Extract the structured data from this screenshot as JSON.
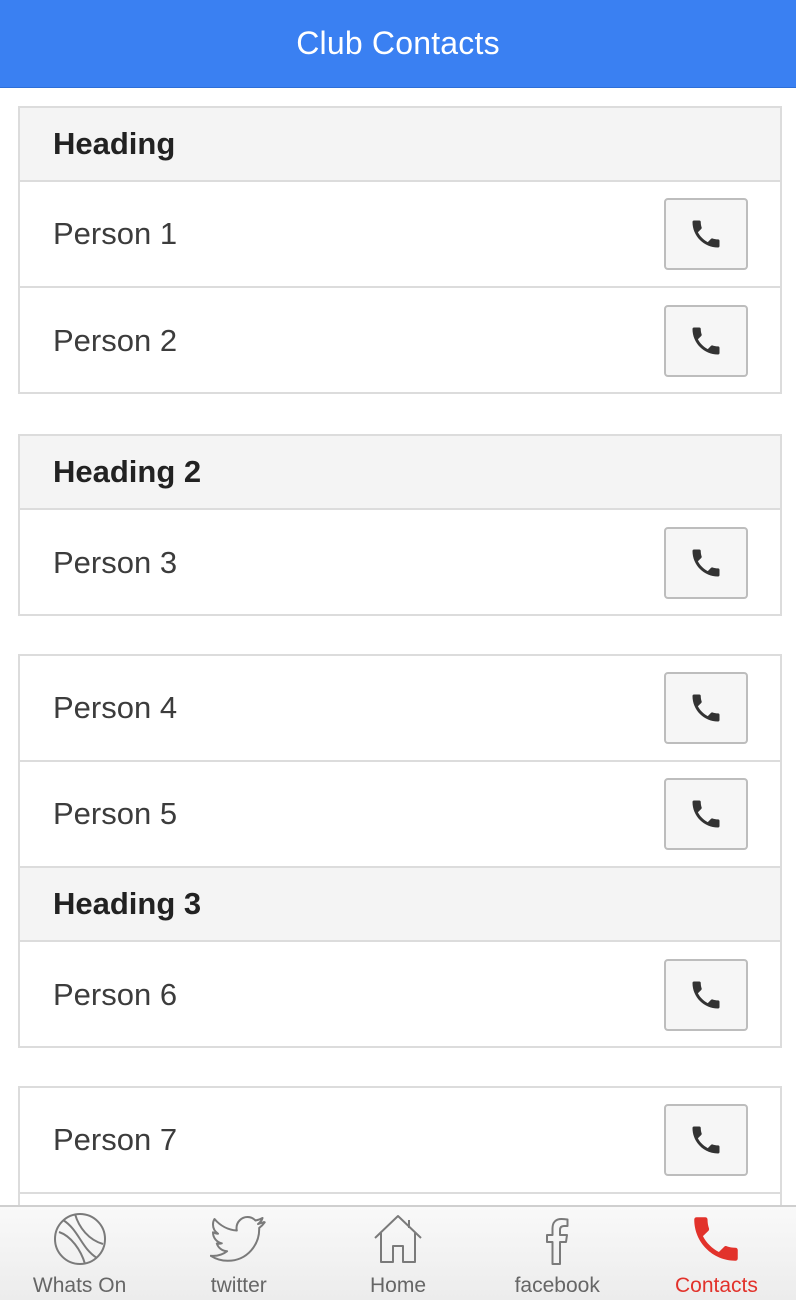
{
  "header": {
    "title": "Club Contacts"
  },
  "cards": [
    {
      "heading": "Heading",
      "people": [
        "Person 1",
        "Person 2"
      ]
    },
    {
      "heading": "Heading 2",
      "people": [
        "Person 3"
      ]
    },
    {
      "people": [
        "Person 4",
        "Person 5"
      ],
      "subheading": "Heading 3",
      "people_after": [
        "Person 6"
      ]
    },
    {
      "people": [
        "Person 7"
      ]
    }
  ],
  "icons": {
    "call": "phone-icon"
  },
  "tabbar": {
    "tabs": [
      {
        "label": "Whats On",
        "icon": "tennis-ball-icon"
      },
      {
        "label": "twitter",
        "icon": "twitter-bird-icon"
      },
      {
        "label": "Home",
        "icon": "house-icon"
      },
      {
        "label": "facebook",
        "icon": "facebook-icon"
      },
      {
        "label": "Contacts",
        "icon": "phone-icon",
        "active": true
      }
    ]
  },
  "colors": {
    "header": "#3a80f2",
    "active_tab": "#e2322b"
  }
}
